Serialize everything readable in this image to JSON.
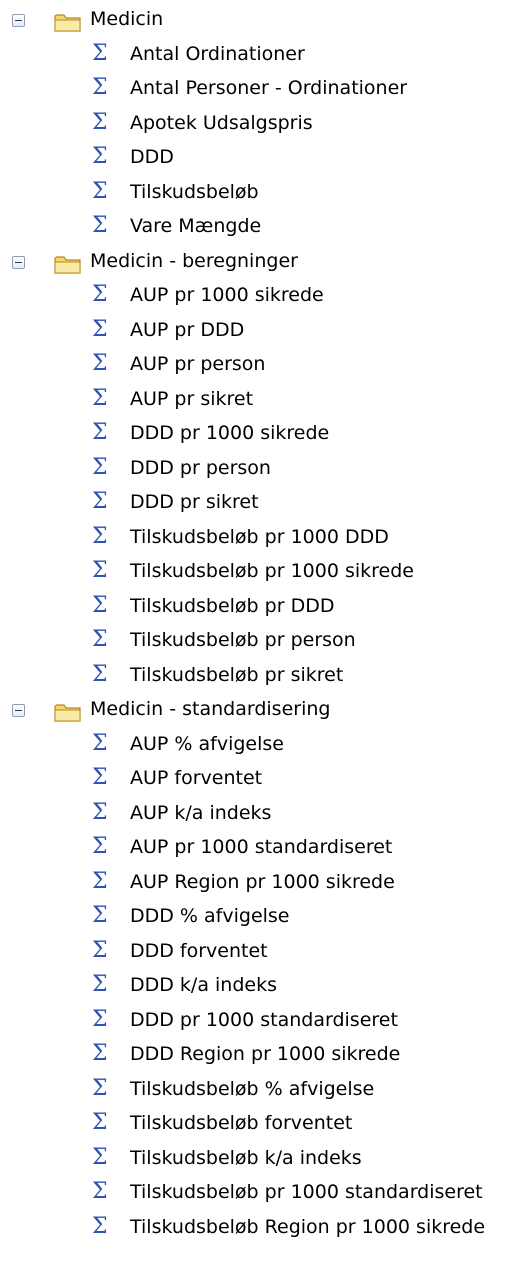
{
  "tree": {
    "groups": [
      {
        "label": "Medicin",
        "items": [
          "Antal Ordinationer",
          "Antal Personer - Ordinationer",
          "Apotek Udsalgspris",
          "DDD",
          "Tilskudsbeløb",
          "Vare Mængde"
        ]
      },
      {
        "label": "Medicin - beregninger",
        "items": [
          "AUP pr 1000 sikrede",
          "AUP pr DDD",
          "AUP pr person",
          "AUP pr sikret",
          "DDD pr 1000 sikrede",
          "DDD pr person",
          "DDD pr sikret",
          "Tilskudsbeløb pr 1000 DDD",
          "Tilskudsbeløb pr 1000 sikrede",
          "Tilskudsbeløb pr DDD",
          "Tilskudsbeløb pr person",
          "Tilskudsbeløb pr sikret"
        ]
      },
      {
        "label": "Medicin - standardisering",
        "items": [
          "AUP % afvigelse",
          "AUP forventet",
          "AUP k/a indeks",
          "AUP pr 1000 standardiseret",
          "AUP Region pr 1000 sikrede",
          "DDD % afvigelse",
          "DDD forventet",
          "DDD k/a indeks",
          "DDD pr 1000 standardiseret",
          "DDD Region pr 1000 sikrede",
          "Tilskudsbeløb % afvigelse",
          "Tilskudsbeløb forventet",
          "Tilskudsbeløb k/a indeks",
          "Tilskudsbeløb pr 1000 standardiseret",
          "Tilskudsbeløb Region pr 1000 sikrede"
        ]
      }
    ],
    "leaf_icon": "sigma-measure-icon",
    "folder_icon": "folder-icon",
    "toggle_icon": "collapse-minus-icon",
    "colors": {
      "sigma": "#2d52b8",
      "folder_fill": "#f6d66f",
      "folder_stroke": "#b38b1d"
    }
  }
}
